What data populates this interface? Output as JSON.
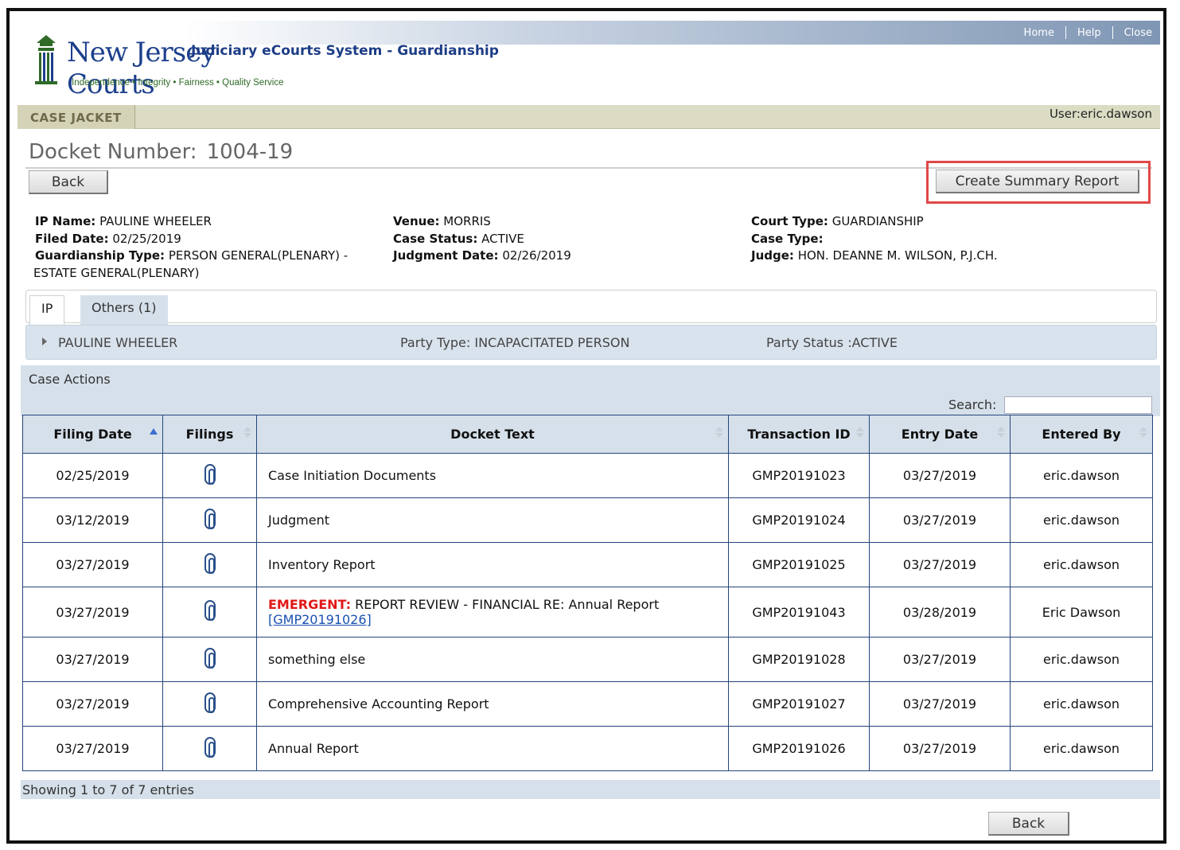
{
  "header": {
    "brand": "New Jersey Courts",
    "tagline": "Independence • Integrity • Fairness • Quality Service",
    "system_title": "Judiciary eCourts System - Guardianship",
    "nav": [
      "Home",
      "Help",
      "Close"
    ]
  },
  "jacket": {
    "tab_label": "CASE JACKET",
    "user": "User:eric.dawson"
  },
  "docket": {
    "label": "Docket Number:",
    "number": "1004-19"
  },
  "buttons": {
    "back": "Back",
    "create_summary": "Create Summary Report",
    "back_bottom": "Back"
  },
  "case_info": {
    "ip_name_label": "IP Name:",
    "ip_name": "PAULINE WHEELER",
    "filed_date_label": "Filed Date:",
    "filed_date": "02/25/2019",
    "guardianship_type_label": "Guardianship Type:",
    "guardianship_type": "PERSON GENERAL(PLENARY) -",
    "guardianship_type_cont": "ESTATE GENERAL(PLENARY)",
    "venue_label": "Venue:",
    "venue": "MORRIS",
    "case_status_label": "Case Status:",
    "case_status": "ACTIVE",
    "judgment_date_label": "Judgment Date:",
    "judgment_date": "02/26/2019",
    "court_type_label": "Court Type:",
    "court_type": "GUARDIANSHIP",
    "case_type_label": "Case Type:",
    "case_type": "",
    "judge_label": "Judge:",
    "judge": "HON. DEANNE M. WILSON, P.J.CH."
  },
  "tabs": [
    {
      "label": "IP"
    },
    {
      "label": "Others (1)"
    }
  ],
  "party": {
    "name": "PAULINE WHEELER",
    "type": "Party Type: INCAPACITATED PERSON",
    "status": "Party Status :ACTIVE"
  },
  "case_actions": {
    "title": "Case Actions",
    "search_label": "Search:",
    "search_value": "",
    "columns": [
      "Filing Date",
      "Filings",
      "Docket Text",
      "Transaction ID",
      "Entry Date",
      "Entered By"
    ],
    "rows": [
      {
        "filing_date": "02/25/2019",
        "docket_text": "Case Initiation Documents",
        "transaction_id": "GMP20191023",
        "entry_date": "03/27/2019",
        "entered_by": "eric.dawson"
      },
      {
        "filing_date": "03/12/2019",
        "docket_text": "Judgment",
        "transaction_id": "GMP20191024",
        "entry_date": "03/27/2019",
        "entered_by": "eric.dawson"
      },
      {
        "filing_date": "03/27/2019",
        "docket_text": "Inventory Report",
        "transaction_id": "GMP20191025",
        "entry_date": "03/27/2019",
        "entered_by": "eric.dawson"
      },
      {
        "filing_date": "03/27/2019",
        "emergent_label": "EMERGENT:",
        "docket_text": "REPORT REVIEW - FINANCIAL RE: Annual Report",
        "docket_link": "[GMP20191026]",
        "transaction_id": "GMP20191043",
        "entry_date": "03/28/2019",
        "entered_by": "Eric Dawson"
      },
      {
        "filing_date": "03/27/2019",
        "docket_text": "something else",
        "transaction_id": "GMP20191028",
        "entry_date": "03/27/2019",
        "entered_by": "eric.dawson"
      },
      {
        "filing_date": "03/27/2019",
        "docket_text": "Comprehensive Accounting Report",
        "transaction_id": "GMP20191027",
        "entry_date": "03/27/2019",
        "entered_by": "eric.dawson"
      },
      {
        "filing_date": "03/27/2019",
        "docket_text": "Annual Report",
        "transaction_id": "GMP20191026",
        "entry_date": "03/27/2019",
        "entered_by": "eric.dawson"
      }
    ],
    "showing": "Showing 1 to 7 of 7 entries"
  }
}
